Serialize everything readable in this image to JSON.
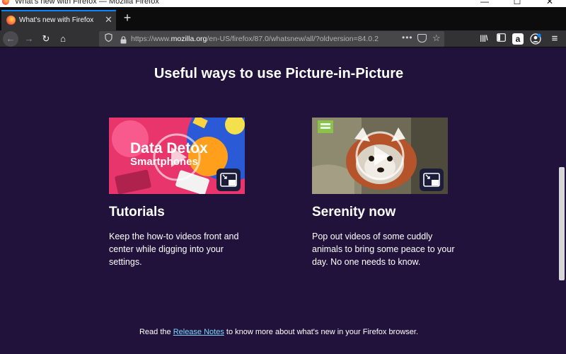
{
  "window": {
    "title": "What's new with Firefox — Mozilla Firefox",
    "controls": {
      "minimize": "—",
      "maximize": "☐",
      "close": "✕"
    }
  },
  "tabs": [
    {
      "title": "What's new with Firefox",
      "close": "✕"
    }
  ],
  "toolbar": {
    "new_tab": "+",
    "back": "←",
    "forward": "→",
    "reload": "↻",
    "home": "⌂",
    "url_prefix": "https://www.",
    "url_host": "mozilla.org",
    "url_path": "/en-US/firefox/87.0/whatsnew/all/?oldversion=84.0.2",
    "page_actions": "•••",
    "bookmark_star": "☆",
    "library": "|||\\",
    "sidebar": "▣",
    "amazon": "a",
    "menu": "≡"
  },
  "page": {
    "heading": "Useful ways to use Picture-in-Picture",
    "cards": [
      {
        "thumb_line1": "Data Detox",
        "thumb_line2": "Smartphones",
        "title": "Tutorials",
        "description": "Keep the how-to videos front and center while digging into your settings."
      },
      {
        "title": "Serenity now",
        "description": "Pop out videos of some cuddly animals to bring some peace to your day. No one needs to know."
      }
    ],
    "footer_before": "Read the ",
    "footer_link": "Release Notes",
    "footer_after": " to know more about what's new in your Firefox browser."
  },
  "colors": {
    "page_bg": "#20123a",
    "link": "#7fd7ff",
    "tab_accent": "#0a84ff"
  }
}
